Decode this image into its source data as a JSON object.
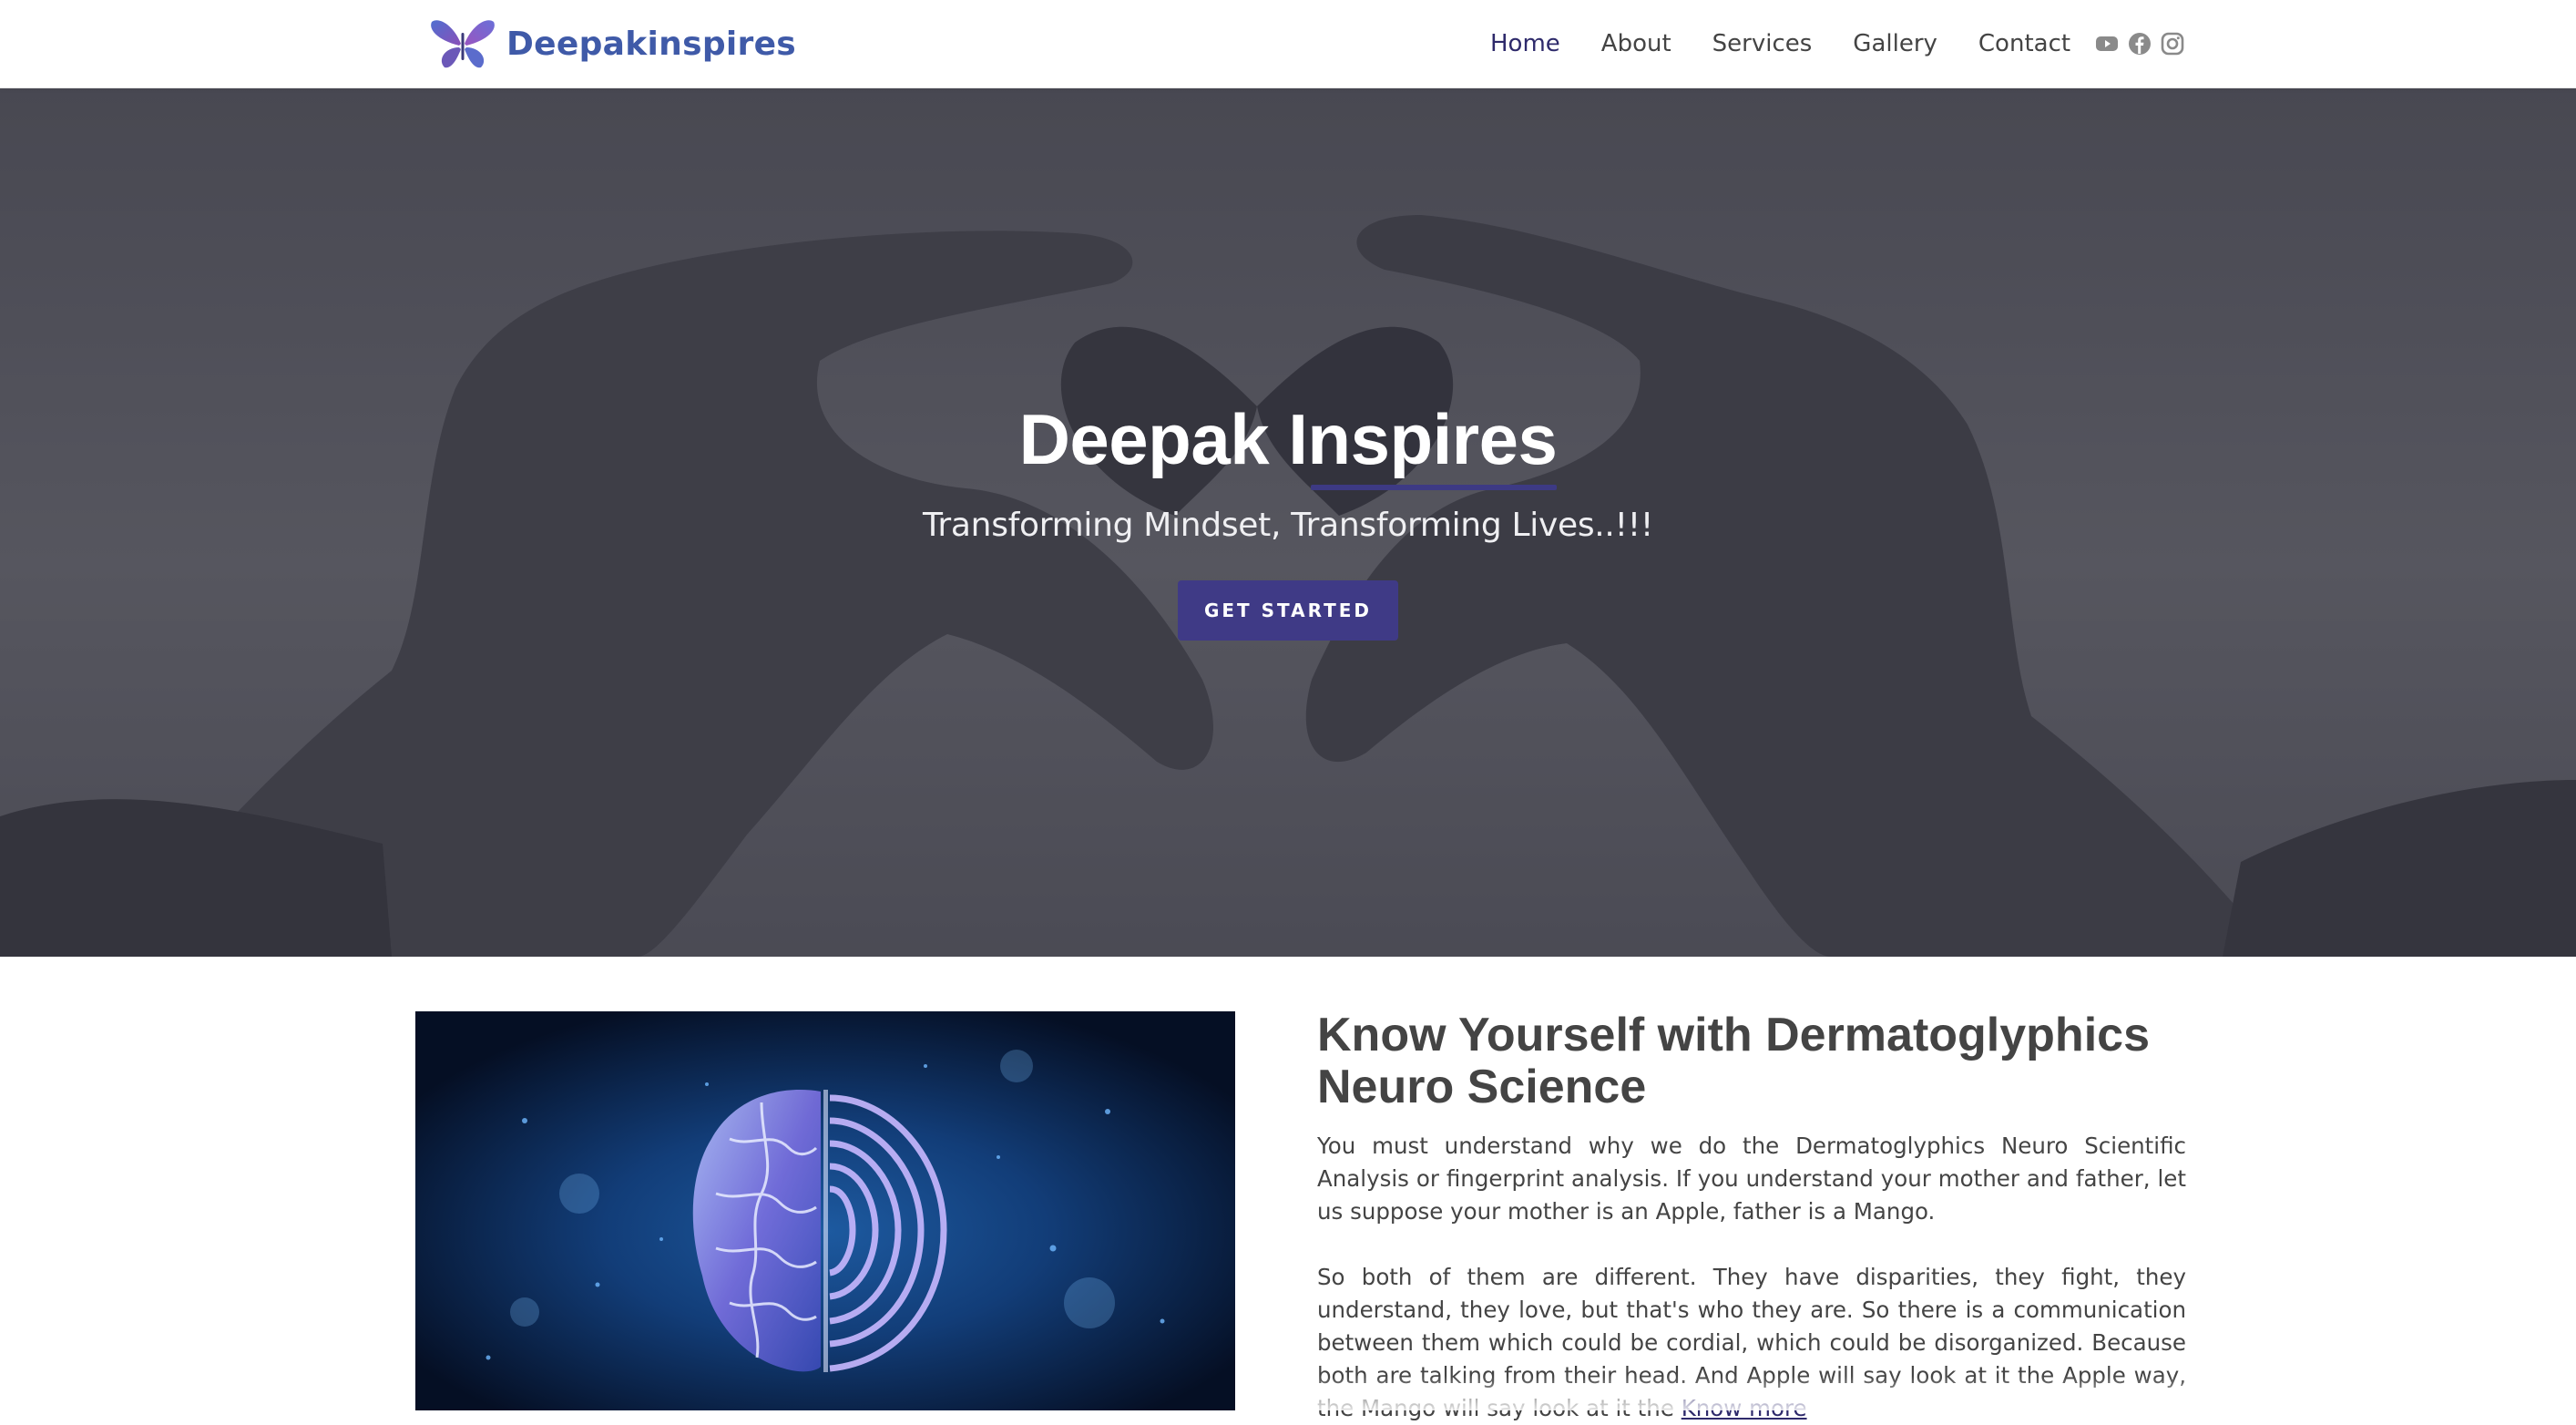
{
  "brand": {
    "name": "Deepakinspires",
    "accent": "#3f3a86",
    "logo_color": "#3f5aa8"
  },
  "nav": {
    "items": [
      {
        "label": "Home",
        "active": true
      },
      {
        "label": "About",
        "active": false
      },
      {
        "label": "Services",
        "active": false
      },
      {
        "label": "Gallery",
        "active": false
      },
      {
        "label": "Contact",
        "active": false
      }
    ]
  },
  "social": {
    "icons": [
      "youtube-icon",
      "facebook-icon",
      "instagram-icon"
    ]
  },
  "hero": {
    "title": "Deepak Inspires",
    "subtitle": "Transforming Mindset, Transforming Lives..!!!",
    "cta": "GET STARTED"
  },
  "about": {
    "title": "Know Yourself with Dermatoglyphics Neuro Science",
    "para1": "You must understand why we do the Dermatoglyphics Neuro Scientific Analysis or fingerprint analysis. If you understand your mother and father, let us suppose your mother is an Apple, father is a Mango.",
    "para2": "So both of them are different. They have disparities, they fight, they understand, they love, but that's who they are. So there is a communication between them which could be cordial, which could be disorganized. Because both are talking from their head. And Apple will say look at it the Apple way, the Mango will say look at it the",
    "know_more": "Know more",
    "image_icon": "brain-fingerprint-image"
  }
}
